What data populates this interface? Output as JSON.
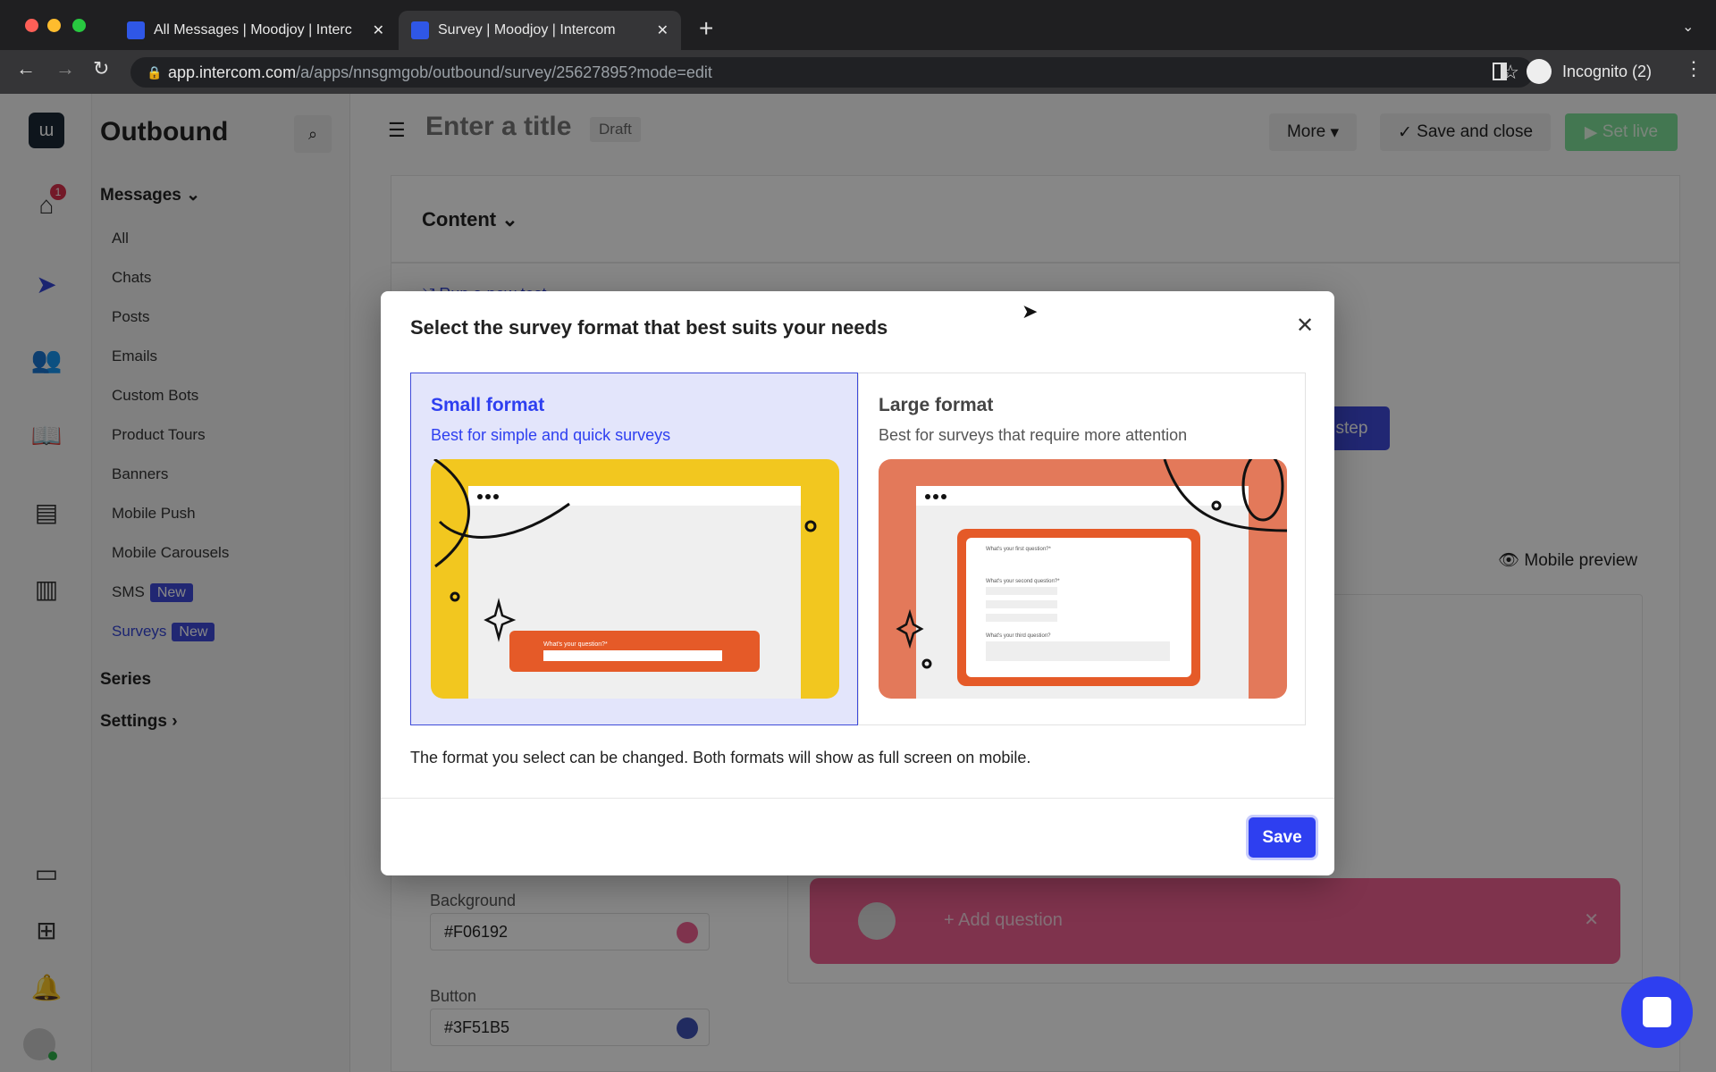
{
  "browser": {
    "tabs": [
      {
        "title": "All Messages | Moodjoy | Interc",
        "active": false
      },
      {
        "title": "Survey | Moodjoy | Intercom",
        "active": true
      }
    ],
    "url_host": "app.intercom.com",
    "url_path": "/a/apps/nnsgmgob/outbound/survey/25627895?mode=edit",
    "profile": "Incognito (2)"
  },
  "rail": {
    "inbox_badge": "1"
  },
  "sidebar": {
    "title": "Outbound",
    "messages_label": "Messages",
    "items": [
      {
        "label": "All"
      },
      {
        "label": "Chats"
      },
      {
        "label": "Posts"
      },
      {
        "label": "Emails"
      },
      {
        "label": "Custom Bots"
      },
      {
        "label": "Product Tours"
      },
      {
        "label": "Banners"
      },
      {
        "label": "Mobile Push"
      },
      {
        "label": "Mobile Carousels"
      },
      {
        "label": "SMS",
        "badge": "New"
      },
      {
        "label": "Surveys",
        "badge": "New",
        "active": true
      }
    ],
    "series": "Series",
    "settings": "Settings"
  },
  "header": {
    "title_placeholder": "Enter a title",
    "status": "Draft",
    "more": "More",
    "save_close": "Save and close",
    "set_live": "Set live"
  },
  "content": {
    "section": "Content",
    "run_test": "Run a new test",
    "step_btn": "step",
    "mobile_preview": "Mobile preview",
    "background_label": "Background",
    "background_value": "#F06192",
    "button_label": "Button",
    "button_value": "#3F51B5",
    "add_question": "+ Add question"
  },
  "modal": {
    "title": "Select the survey format that best suits your needs",
    "options": [
      {
        "title": "Small format",
        "subtitle": "Best for simple and quick surveys",
        "selected": true,
        "preview_question": "What's your question?*"
      },
      {
        "title": "Large format",
        "subtitle": "Best for surveys that require more attention",
        "selected": false,
        "preview_questions": [
          "What's your first question?*",
          "What's your second question?*",
          "What's your third question?"
        ]
      }
    ],
    "note": "The format you select can be changed. Both formats will show as full screen on mobile.",
    "save": "Save"
  },
  "colors": {
    "accent": "#2e3ff0",
    "background_swatch": "#F06192",
    "button_swatch": "#3F51B5",
    "selected_bg": "#e3e5fb"
  }
}
